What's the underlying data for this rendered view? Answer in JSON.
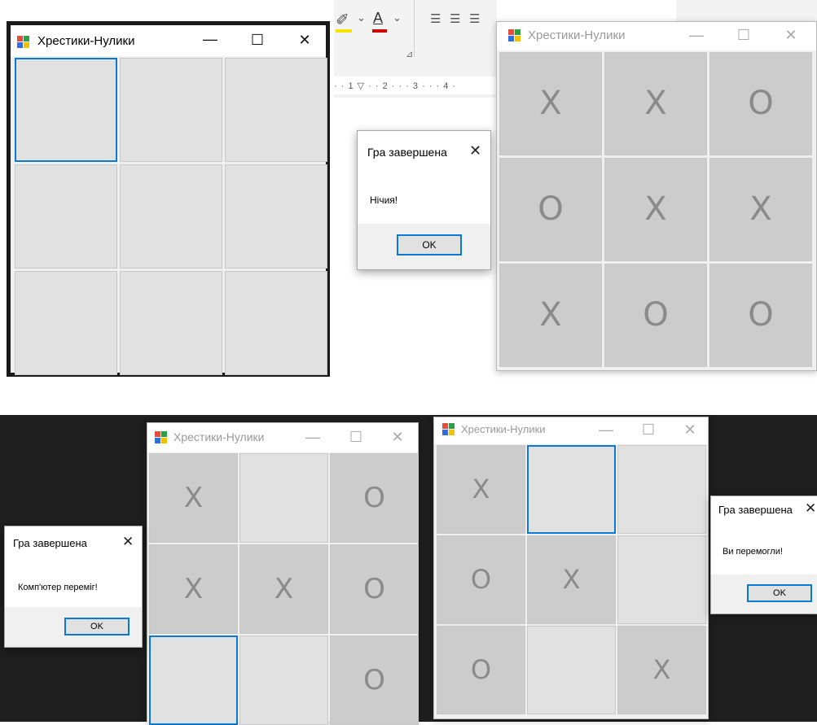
{
  "app_title": "Хрестики-Нулики",
  "window_buttons": {
    "minimize": "—",
    "maximize": "☐",
    "close": "✕"
  },
  "ribbon": {
    "highlight_glyph": "✐",
    "font_color_glyph": "A",
    "chevron": "⌄",
    "align_glyph": "☰",
    "launcher_glyph": "⊿",
    "ruler_text": "· · 1 ▽ · · 2 · · · 3 · · · 4 ·",
    "highlight_color": "#f5e400",
    "font_color": "#d00000"
  },
  "windows": [
    {
      "id": "empty",
      "cells": [
        "",
        "",
        "",
        "",
        "",
        "",
        "",
        "",
        ""
      ],
      "focused_cell": 0
    },
    {
      "id": "draw",
      "cells": [
        "X",
        "X",
        "O",
        "O",
        "X",
        "X",
        "X",
        "O",
        "O"
      ],
      "focused_cell": -1
    },
    {
      "id": "computer",
      "cells": [
        "X",
        "",
        "O",
        "X",
        "X",
        "O",
        "",
        "",
        "O"
      ],
      "focused_cell": 6
    },
    {
      "id": "player",
      "cells": [
        "X",
        "",
        "",
        "O",
        "X",
        "",
        "O",
        "",
        "X"
      ],
      "focused_cell": 1
    }
  ],
  "dialogs": [
    {
      "title": "Гра завершена",
      "message": "Нічия!",
      "ok": "OK",
      "close": "✕"
    },
    {
      "title": "Гра завершена",
      "message": "Комп'ютер переміг!",
      "ok": "OK",
      "close": "✕"
    },
    {
      "title": "Гра завершена",
      "message": "Ви перемогли!",
      "ok": "OK",
      "close": "✕"
    }
  ],
  "colors": {
    "accent": "#0a78d7",
    "cell_empty": "#e1e1e1",
    "cell_played": "#cccccc",
    "mark": "#8a8a8a",
    "dark_bg": "#1e1e1e",
    "icon": [
      "#e84c3d",
      "#2ea043",
      "#2f6fdd",
      "#f2c200"
    ]
  }
}
